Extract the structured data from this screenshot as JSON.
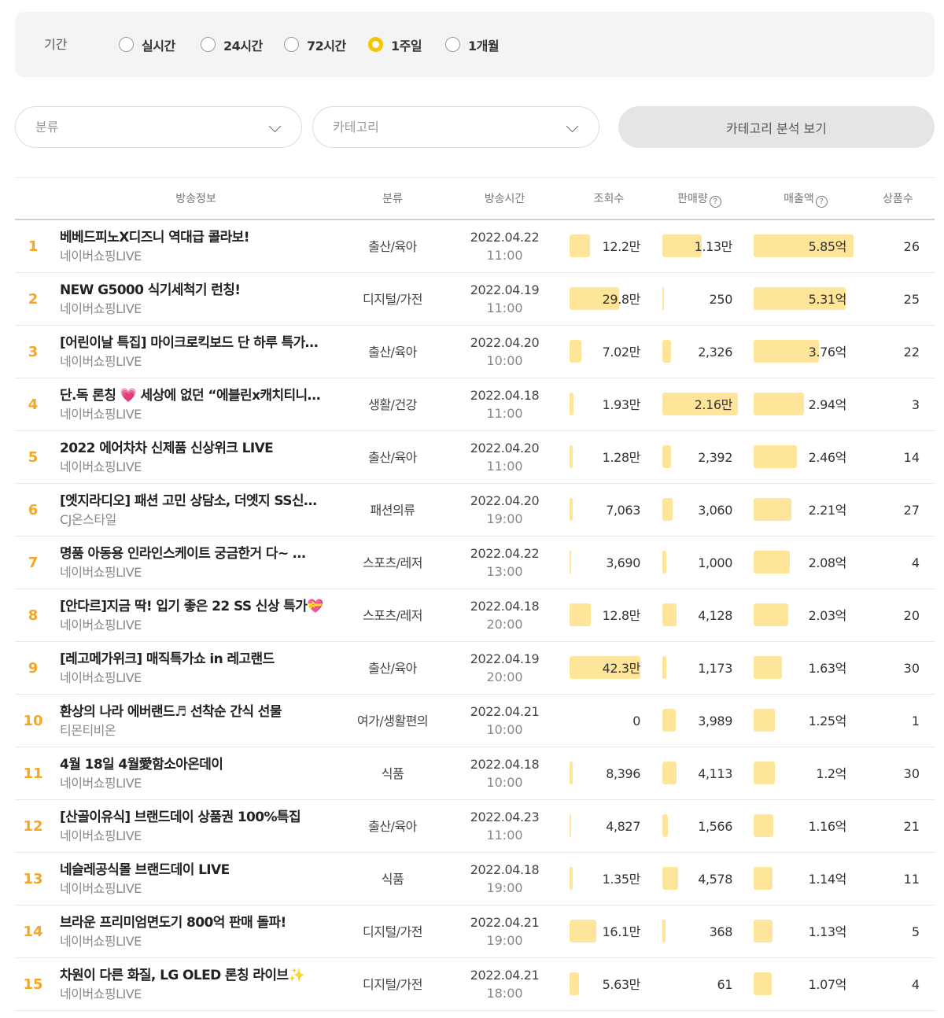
{
  "period": {
    "label": "기간",
    "options": [
      "실시간",
      "24시간",
      "72시간",
      "1주일",
      "1개월"
    ],
    "selected": "1주일"
  },
  "filters": {
    "classification_placeholder": "분류",
    "category_placeholder": "카테고리",
    "analysis_button": "카테고리 분석 보기"
  },
  "table": {
    "headers": {
      "info": "방송정보",
      "category": "분류",
      "time": "방송시간",
      "views": "조회수",
      "sales": "판매량",
      "revenue": "매출액",
      "products": "상품수"
    },
    "rows": [
      {
        "rank": "1",
        "title": "베베드피노X디즈니 역대급 콜라보!",
        "channel": "네이버쇼핑LIVE",
        "category": "출산/육아",
        "date": "2022.04.22",
        "time": "11:00",
        "views": "12.2만",
        "views_bar": 0.29,
        "sales": "1.13만",
        "sales_bar": 0.52,
        "revenue": "5.85억",
        "revenue_bar": 1.0,
        "products": "26"
      },
      {
        "rank": "2",
        "title": "NEW G5000 식기세척기 런칭!",
        "channel": "네이버쇼핑LIVE",
        "category": "디지털/가전",
        "date": "2022.04.19",
        "time": "11:00",
        "views": "29.8만",
        "views_bar": 0.7,
        "sales": "250",
        "sales_bar": 0.01,
        "revenue": "5.31억",
        "revenue_bar": 0.92,
        "products": "25"
      },
      {
        "rank": "3",
        "title": "[어린이날 특집] 마이크로킥보드 단 하루 특가…",
        "channel": "네이버쇼핑LIVE",
        "category": "출산/육아",
        "date": "2022.04.20",
        "time": "10:00",
        "views": "7.02만",
        "views_bar": 0.17,
        "sales": "2,326",
        "sales_bar": 0.11,
        "revenue": "3.76억",
        "revenue_bar": 0.65,
        "products": "22"
      },
      {
        "rank": "4",
        "title": "단.독 론칭 💗 세상에 없던 “에블린x캐치티니…",
        "channel": "네이버쇼핑LIVE",
        "category": "생활/건강",
        "date": "2022.04.18",
        "time": "11:00",
        "views": "1.93만",
        "views_bar": 0.05,
        "sales": "2.16만",
        "sales_bar": 1.0,
        "revenue": "2.94억",
        "revenue_bar": 0.5,
        "products": "3"
      },
      {
        "rank": "5",
        "title": "2022 에어차차 신제품 신상위크 LIVE",
        "channel": "네이버쇼핑LIVE",
        "category": "출산/육아",
        "date": "2022.04.20",
        "time": "11:00",
        "views": "1.28만",
        "views_bar": 0.03,
        "sales": "2,392",
        "sales_bar": 0.11,
        "revenue": "2.46억",
        "revenue_bar": 0.43,
        "products": "14"
      },
      {
        "rank": "6",
        "title": "[엣지라디오] 패션 고민 상담소, 더엣지 SS신…",
        "channel": "CJ온스타일",
        "category": "패션의류",
        "date": "2022.04.20",
        "time": "19:00",
        "views": "7,063",
        "views_bar": 0.02,
        "sales": "3,060",
        "sales_bar": 0.14,
        "revenue": "2.21억",
        "revenue_bar": 0.38,
        "products": "27"
      },
      {
        "rank": "7",
        "title": "명품 아동용 인라인스케이트 궁금한거 다~ …",
        "channel": "네이버쇼핑LIVE",
        "category": "스포츠/레저",
        "date": "2022.04.22",
        "time": "13:00",
        "views": "3,690",
        "views_bar": 0.01,
        "sales": "1,000",
        "sales_bar": 0.05,
        "revenue": "2.08억",
        "revenue_bar": 0.36,
        "products": "4"
      },
      {
        "rank": "8",
        "title": "[안다르]지금 딱! 입기 좋은 22 SS 신상 특가💝",
        "channel": "네이버쇼핑LIVE",
        "category": "스포츠/레저",
        "date": "2022.04.18",
        "time": "20:00",
        "views": "12.8만",
        "views_bar": 0.3,
        "sales": "4,128",
        "sales_bar": 0.19,
        "revenue": "2.03억",
        "revenue_bar": 0.35,
        "products": "20"
      },
      {
        "rank": "9",
        "title": "[레고메가위크] 매직특가쇼 in 레고랜드",
        "channel": "네이버쇼핑LIVE",
        "category": "출산/육아",
        "date": "2022.04.19",
        "time": "20:00",
        "views": "42.3만",
        "views_bar": 1.0,
        "sales": "1,173",
        "sales_bar": 0.05,
        "revenue": "1.63억",
        "revenue_bar": 0.28,
        "products": "30"
      },
      {
        "rank": "10",
        "title": "환상의 나라 에버랜드♬ 선착순 간식 선물",
        "channel": "티몬티비온",
        "category": "여가/생활편의",
        "date": "2022.04.21",
        "time": "10:00",
        "views": "0",
        "views_bar": 0.0,
        "sales": "3,989",
        "sales_bar": 0.18,
        "revenue": "1.25억",
        "revenue_bar": 0.21,
        "products": "1"
      },
      {
        "rank": "11",
        "title": "4월 18일 4월愛함소아온데이",
        "channel": "네이버쇼핑LIVE",
        "category": "식품",
        "date": "2022.04.18",
        "time": "10:00",
        "views": "8,396",
        "views_bar": 0.02,
        "sales": "4,113",
        "sales_bar": 0.19,
        "revenue": "1.2억",
        "revenue_bar": 0.21,
        "products": "30"
      },
      {
        "rank": "12",
        "title": "[산골이유식] 브랜드데이 상품권 100%특집",
        "channel": "네이버쇼핑LIVE",
        "category": "출산/육아",
        "date": "2022.04.23",
        "time": "11:00",
        "views": "4,827",
        "views_bar": 0.01,
        "sales": "1,566",
        "sales_bar": 0.07,
        "revenue": "1.16억",
        "revenue_bar": 0.2,
        "products": "21"
      },
      {
        "rank": "13",
        "title": "네슬레공식몰 브랜드데이 LIVE",
        "channel": "네이버쇼핑LIVE",
        "category": "식품",
        "date": "2022.04.18",
        "time": "19:00",
        "views": "1.35만",
        "views_bar": 0.03,
        "sales": "4,578",
        "sales_bar": 0.21,
        "revenue": "1.14억",
        "revenue_bar": 0.19,
        "products": "11"
      },
      {
        "rank": "14",
        "title": "브라운 프리미엄면도기 800억 판매 돌파!",
        "channel": "네이버쇼핑LIVE",
        "category": "디지털/가전",
        "date": "2022.04.21",
        "time": "19:00",
        "views": "16.1만",
        "views_bar": 0.38,
        "sales": "368",
        "sales_bar": 0.02,
        "revenue": "1.13억",
        "revenue_bar": 0.19,
        "products": "5"
      },
      {
        "rank": "15",
        "title": "차원이 다른 화질, LG OLED 론칭 라이브✨",
        "channel": "네이버쇼핑LIVE",
        "category": "디지털/가전",
        "date": "2022.04.21",
        "time": "18:00",
        "views": "5.63만",
        "views_bar": 0.13,
        "sales": "61",
        "sales_bar": 0.0,
        "revenue": "1.07억",
        "revenue_bar": 0.18,
        "products": "4"
      }
    ]
  }
}
